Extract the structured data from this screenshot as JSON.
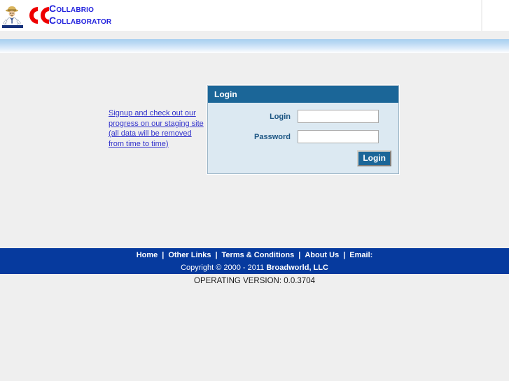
{
  "header": {
    "mascot_icon": "mascot-figure-icon",
    "logo_icon": "double-c-logo-icon",
    "brand_line1_cap": "C",
    "brand_line1_rest": "OLLABRIO",
    "brand_line2_cap": "C",
    "brand_line2_rest": "OLLABORATOR",
    "brand_color": "#2222dd",
    "logo_color": "#ee0000"
  },
  "signup": {
    "text": "Signup and check out our progress on our staging site (all data will be removed from time to time)",
    "color": "#3333cc"
  },
  "login_panel": {
    "title": "Login",
    "title_bg": "#1b6698",
    "panel_bg": "#dce9f2",
    "fields": [
      {
        "label": "Login",
        "value": "",
        "placeholder": "",
        "type": "text",
        "name": "login-input"
      },
      {
        "label": "Password",
        "value": "",
        "placeholder": "",
        "type": "password",
        "name": "password-input"
      }
    ],
    "submit_label": "Login"
  },
  "footer": {
    "bar_color": "#063a9e",
    "nav": [
      {
        "label": "Home"
      },
      {
        "label": "Other Links"
      },
      {
        "label": "Terms & Conditions"
      },
      {
        "label": "About Us"
      },
      {
        "label": "Email:"
      }
    ],
    "separator": "|",
    "copyright_prefix": "Copyright © 2000 - 2011 ",
    "copyright_company": "Broadworld, LLC",
    "version": "OPERATING VERSION: 0.0.3704"
  }
}
